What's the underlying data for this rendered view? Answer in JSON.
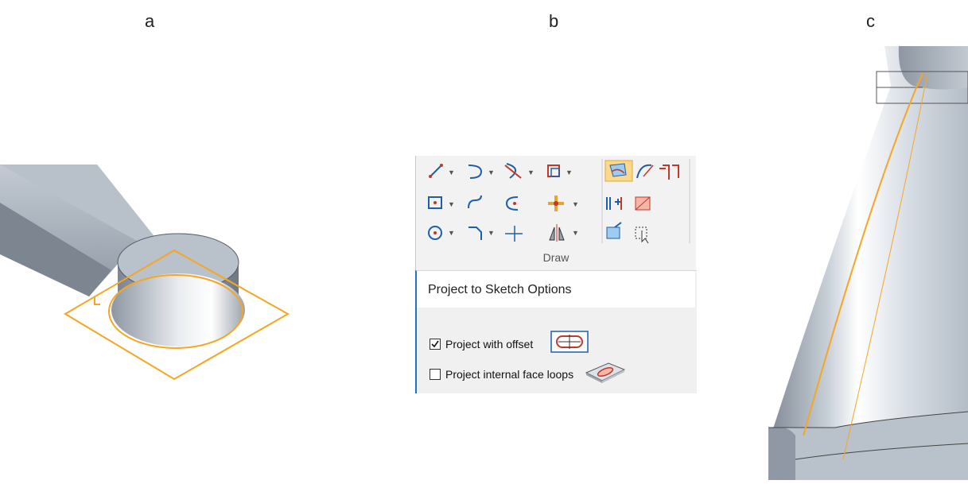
{
  "panels": {
    "a": "a",
    "b": "b",
    "c": "c"
  },
  "ribbon": {
    "group_label": "Draw",
    "tools": [
      "line-icon",
      "arc-icon",
      "trim-icon",
      "offset-icon",
      "project-to-sketch-icon",
      "curve-icon",
      "include-icon",
      "rectangle-icon",
      "tangent-arc-icon",
      "fillet-icon",
      "move-icon",
      "symmetric-offset-icon",
      "fill-icon",
      "circle-icon",
      "chamfer-icon",
      "extend-icon",
      "mirror-icon",
      "zone-icon",
      "select-icon"
    ],
    "active_tool": "project-to-sketch-icon"
  },
  "options_panel": {
    "title": "Project to Sketch Options",
    "items": [
      {
        "label": "Project with offset",
        "checked": true,
        "icon": "offset-loop-icon"
      },
      {
        "label": "Project internal face loops",
        "checked": false,
        "icon": "face-loops-icon"
      }
    ]
  },
  "colors": {
    "highlight": "#f5a623",
    "accent": "#1f72c8",
    "model": "#a9b1bc"
  }
}
